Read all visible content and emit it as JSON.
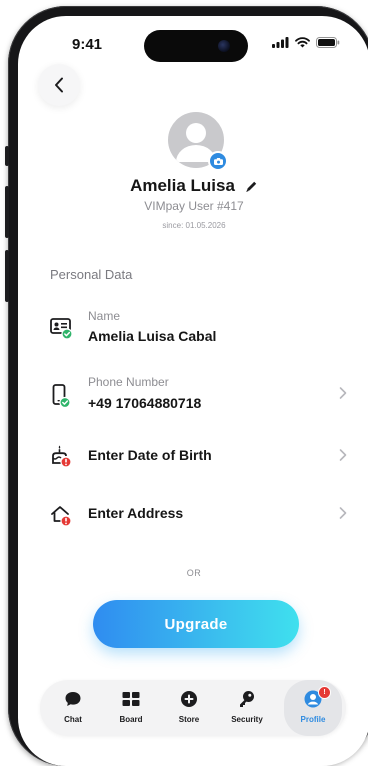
{
  "status_bar": {
    "time": "9:41"
  },
  "profile": {
    "name": "Amelia Luisa",
    "user_id": "VIMpay User #417",
    "since": "since: 01.05.2026"
  },
  "personal_data": {
    "section_title": "Personal Data",
    "name_field": {
      "label": "Name",
      "value": "Amelia Luisa Cabal",
      "status": "verified"
    },
    "phone_field": {
      "label": "Phone Number",
      "value": "+49 17064880718",
      "status": "verified"
    },
    "birth_field": {
      "text": "Enter Date of Birth",
      "status": "missing"
    },
    "address_field": {
      "text": "Enter Address",
      "status": "missing"
    }
  },
  "separator_text": "OR",
  "upgrade_label": "Upgrade",
  "tabs": [
    {
      "label": "Chat",
      "icon": "chat-bubble-icon"
    },
    {
      "label": "Board",
      "icon": "board-grid-icon"
    },
    {
      "label": "Store",
      "icon": "store-plus-icon"
    },
    {
      "label": "Security",
      "icon": "security-key-icon"
    },
    {
      "label": "Profile",
      "icon": "profile-person-icon",
      "active": true,
      "badge": "!"
    }
  ],
  "colors": {
    "accent": "#2f8be0",
    "verified": "#2fb46a",
    "alert": "#e53935",
    "upgrade_gradient_start": "#2f8cf0",
    "upgrade_gradient_end": "#3fe0ee"
  }
}
